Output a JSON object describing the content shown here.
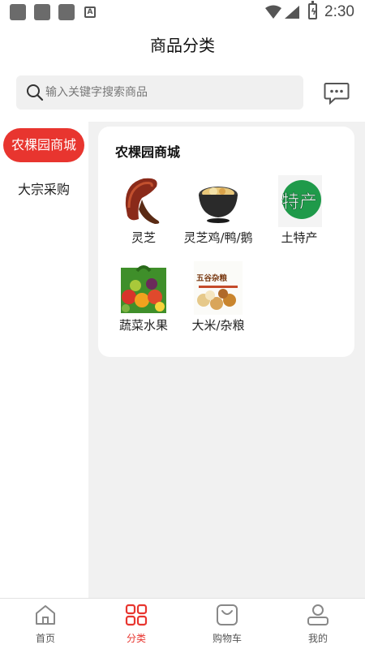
{
  "status_bar": {
    "time": "2:30",
    "icons": [
      "notification-square-icon",
      "notification-square-icon",
      "notification-square-icon",
      "a-notification-icon",
      "wifi-icon",
      "signal-icon",
      "battery-charging-icon"
    ]
  },
  "header": {
    "title": "商品分类"
  },
  "search": {
    "placeholder": "输入关键字搜索商品",
    "value": ""
  },
  "sidebar": {
    "items": [
      {
        "label": "农棵园商城",
        "active": true
      },
      {
        "label": "大宗采购",
        "active": false
      }
    ]
  },
  "main": {
    "section_title": "农棵园商城",
    "categories": [
      {
        "label": "灵芝",
        "icon": "lingzhi-image"
      },
      {
        "label": "灵芝鸡/鸭/鹅",
        "icon": "poultry-soup-image"
      },
      {
        "label": "土特产",
        "icon": "specialty-image",
        "icon_text": "特产"
      },
      {
        "label": "蔬菜水果",
        "icon": "vegetables-fruits-image"
      },
      {
        "label": "大米/杂粮",
        "icon": "grains-image",
        "icon_text": "五谷杂粮"
      }
    ]
  },
  "tabbar": {
    "items": [
      {
        "label": "首页",
        "icon": "home-icon",
        "active": false
      },
      {
        "label": "分类",
        "icon": "category-grid-icon",
        "active": true
      },
      {
        "label": "购物车",
        "icon": "cart-bag-icon",
        "active": false
      },
      {
        "label": "我的",
        "icon": "profile-icon",
        "active": false
      }
    ]
  },
  "colors": {
    "accent": "#e8352f",
    "content_bg": "#f1f1f1",
    "search_bg": "#f0f0f0"
  }
}
